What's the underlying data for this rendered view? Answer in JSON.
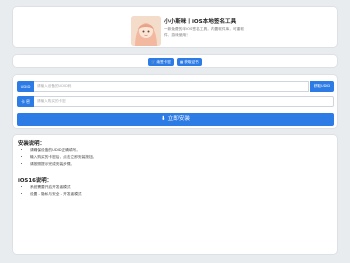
{
  "header": {
    "title": "小小斯咪丨iOS本地签名工具",
    "description": "一款免费的半iOS签名工具，内置软件库，可重软件、游戏使用！"
  },
  "actions": {
    "renew_label": "续签卡密",
    "cert_label": "获取证书"
  },
  "form": {
    "udid_prefix": "UDID",
    "udid_placeholder": "请输入设备的UDID码",
    "get_udid_label": "获取UDID",
    "key_prefix": "卡 密",
    "key_placeholder": "请输入购买的卡密",
    "install_label": "立即安装"
  },
  "instructions": {
    "install_title": "安装说明：",
    "install_items": [
      "请确保设备的UDID正确填写。",
      "输入购买的卡密后，点击立即安装按钮。",
      "请按照提示完成安装步骤。"
    ],
    "ios16_title": "iOS16说明：",
    "ios16_items": [
      "系统需要开启开发者模式",
      "设置 - 隐私与安全 - 开发者模式"
    ]
  },
  "colors": {
    "accent": "#2d7be5",
    "background": "#e9ecef"
  }
}
